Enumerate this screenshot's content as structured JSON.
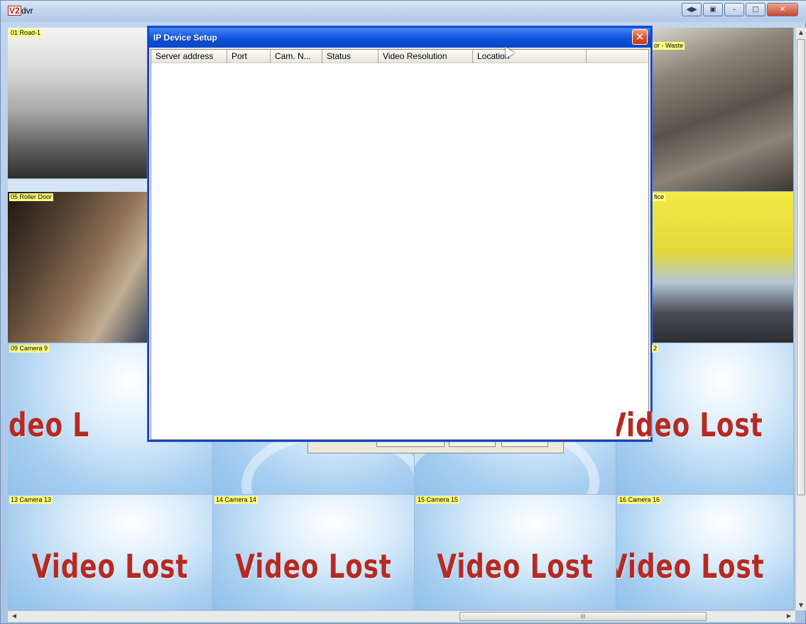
{
  "app": {
    "title": "dvr",
    "icon": "V2"
  },
  "window_controls": {
    "extra1": "◀▶",
    "extra2": "▣",
    "minimize": "–",
    "maximize": "□",
    "close": "✕"
  },
  "cameras": [
    {
      "label": "01 Road-1",
      "type": "feed"
    },
    {
      "label": "or - Waste",
      "type": "feed"
    },
    {
      "label": "05 Roller Door",
      "type": "feed"
    },
    {
      "label": "fice",
      "type": "feed"
    },
    {
      "label": "09 Camera 9",
      "type": "lost"
    },
    {
      "label": "2",
      "type": "lost"
    },
    {
      "label": "13 Camera 13",
      "type": "lost"
    },
    {
      "label": "14 Camera 14",
      "type": "lost"
    },
    {
      "label": "15 Camera 15",
      "type": "lost"
    },
    {
      "label": "16 Camera 16",
      "type": "lost"
    }
  ],
  "video_lost_text": "Video Lost",
  "video_lost_partial_left": "Video L",
  "video_lost_partial_right": "Video Lost",
  "dialog": {
    "title": "IP Device Setup",
    "close": "✕",
    "columns": [
      "Server address",
      "Port",
      "Cam. N...",
      "Status",
      "Video Resolution",
      "Location",
      ""
    ]
  },
  "scrollbar": {
    "h_grip": "III"
  }
}
